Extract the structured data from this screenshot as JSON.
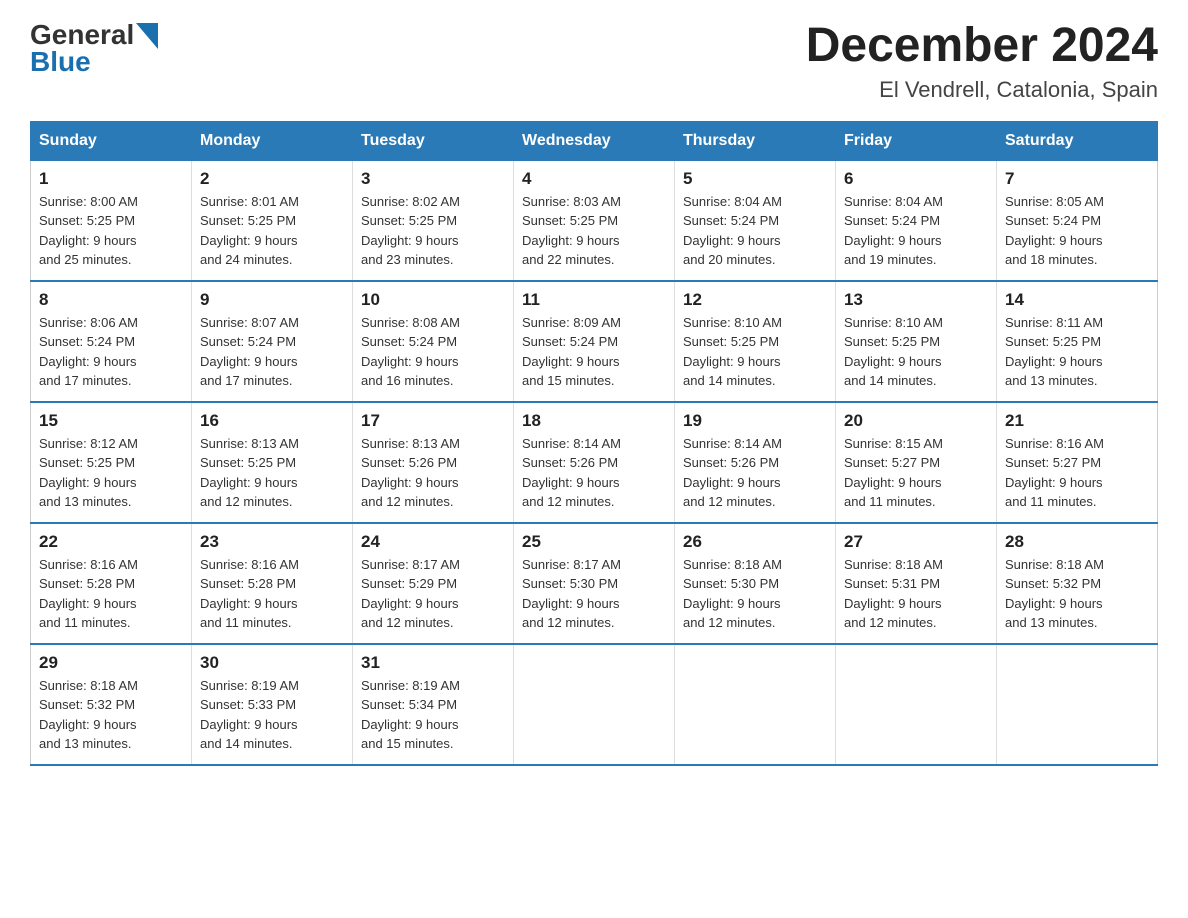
{
  "header": {
    "logo_general": "General",
    "logo_blue": "Blue",
    "month_title": "December 2024",
    "subtitle": "El Vendrell, Catalonia, Spain"
  },
  "days_of_week": [
    "Sunday",
    "Monday",
    "Tuesday",
    "Wednesday",
    "Thursday",
    "Friday",
    "Saturday"
  ],
  "weeks": [
    [
      {
        "day": "1",
        "sunrise": "8:00 AM",
        "sunset": "5:25 PM",
        "daylight": "9 hours and 25 minutes."
      },
      {
        "day": "2",
        "sunrise": "8:01 AM",
        "sunset": "5:25 PM",
        "daylight": "9 hours and 24 minutes."
      },
      {
        "day": "3",
        "sunrise": "8:02 AM",
        "sunset": "5:25 PM",
        "daylight": "9 hours and 23 minutes."
      },
      {
        "day": "4",
        "sunrise": "8:03 AM",
        "sunset": "5:25 PM",
        "daylight": "9 hours and 22 minutes."
      },
      {
        "day": "5",
        "sunrise": "8:04 AM",
        "sunset": "5:24 PM",
        "daylight": "9 hours and 20 minutes."
      },
      {
        "day": "6",
        "sunrise": "8:04 AM",
        "sunset": "5:24 PM",
        "daylight": "9 hours and 19 minutes."
      },
      {
        "day": "7",
        "sunrise": "8:05 AM",
        "sunset": "5:24 PM",
        "daylight": "9 hours and 18 minutes."
      }
    ],
    [
      {
        "day": "8",
        "sunrise": "8:06 AM",
        "sunset": "5:24 PM",
        "daylight": "9 hours and 17 minutes."
      },
      {
        "day": "9",
        "sunrise": "8:07 AM",
        "sunset": "5:24 PM",
        "daylight": "9 hours and 17 minutes."
      },
      {
        "day": "10",
        "sunrise": "8:08 AM",
        "sunset": "5:24 PM",
        "daylight": "9 hours and 16 minutes."
      },
      {
        "day": "11",
        "sunrise": "8:09 AM",
        "sunset": "5:24 PM",
        "daylight": "9 hours and 15 minutes."
      },
      {
        "day": "12",
        "sunrise": "8:10 AM",
        "sunset": "5:25 PM",
        "daylight": "9 hours and 14 minutes."
      },
      {
        "day": "13",
        "sunrise": "8:10 AM",
        "sunset": "5:25 PM",
        "daylight": "9 hours and 14 minutes."
      },
      {
        "day": "14",
        "sunrise": "8:11 AM",
        "sunset": "5:25 PM",
        "daylight": "9 hours and 13 minutes."
      }
    ],
    [
      {
        "day": "15",
        "sunrise": "8:12 AM",
        "sunset": "5:25 PM",
        "daylight": "9 hours and 13 minutes."
      },
      {
        "day": "16",
        "sunrise": "8:13 AM",
        "sunset": "5:25 PM",
        "daylight": "9 hours and 12 minutes."
      },
      {
        "day": "17",
        "sunrise": "8:13 AM",
        "sunset": "5:26 PM",
        "daylight": "9 hours and 12 minutes."
      },
      {
        "day": "18",
        "sunrise": "8:14 AM",
        "sunset": "5:26 PM",
        "daylight": "9 hours and 12 minutes."
      },
      {
        "day": "19",
        "sunrise": "8:14 AM",
        "sunset": "5:26 PM",
        "daylight": "9 hours and 12 minutes."
      },
      {
        "day": "20",
        "sunrise": "8:15 AM",
        "sunset": "5:27 PM",
        "daylight": "9 hours and 11 minutes."
      },
      {
        "day": "21",
        "sunrise": "8:16 AM",
        "sunset": "5:27 PM",
        "daylight": "9 hours and 11 minutes."
      }
    ],
    [
      {
        "day": "22",
        "sunrise": "8:16 AM",
        "sunset": "5:28 PM",
        "daylight": "9 hours and 11 minutes."
      },
      {
        "day": "23",
        "sunrise": "8:16 AM",
        "sunset": "5:28 PM",
        "daylight": "9 hours and 11 minutes."
      },
      {
        "day": "24",
        "sunrise": "8:17 AM",
        "sunset": "5:29 PM",
        "daylight": "9 hours and 12 minutes."
      },
      {
        "day": "25",
        "sunrise": "8:17 AM",
        "sunset": "5:30 PM",
        "daylight": "9 hours and 12 minutes."
      },
      {
        "day": "26",
        "sunrise": "8:18 AM",
        "sunset": "5:30 PM",
        "daylight": "9 hours and 12 minutes."
      },
      {
        "day": "27",
        "sunrise": "8:18 AM",
        "sunset": "5:31 PM",
        "daylight": "9 hours and 12 minutes."
      },
      {
        "day": "28",
        "sunrise": "8:18 AM",
        "sunset": "5:32 PM",
        "daylight": "9 hours and 13 minutes."
      }
    ],
    [
      {
        "day": "29",
        "sunrise": "8:18 AM",
        "sunset": "5:32 PM",
        "daylight": "9 hours and 13 minutes."
      },
      {
        "day": "30",
        "sunrise": "8:19 AM",
        "sunset": "5:33 PM",
        "daylight": "9 hours and 14 minutes."
      },
      {
        "day": "31",
        "sunrise": "8:19 AM",
        "sunset": "5:34 PM",
        "daylight": "9 hours and 15 minutes."
      },
      null,
      null,
      null,
      null
    ]
  ],
  "labels": {
    "sunrise": "Sunrise:",
    "sunset": "Sunset:",
    "daylight": "Daylight:"
  }
}
